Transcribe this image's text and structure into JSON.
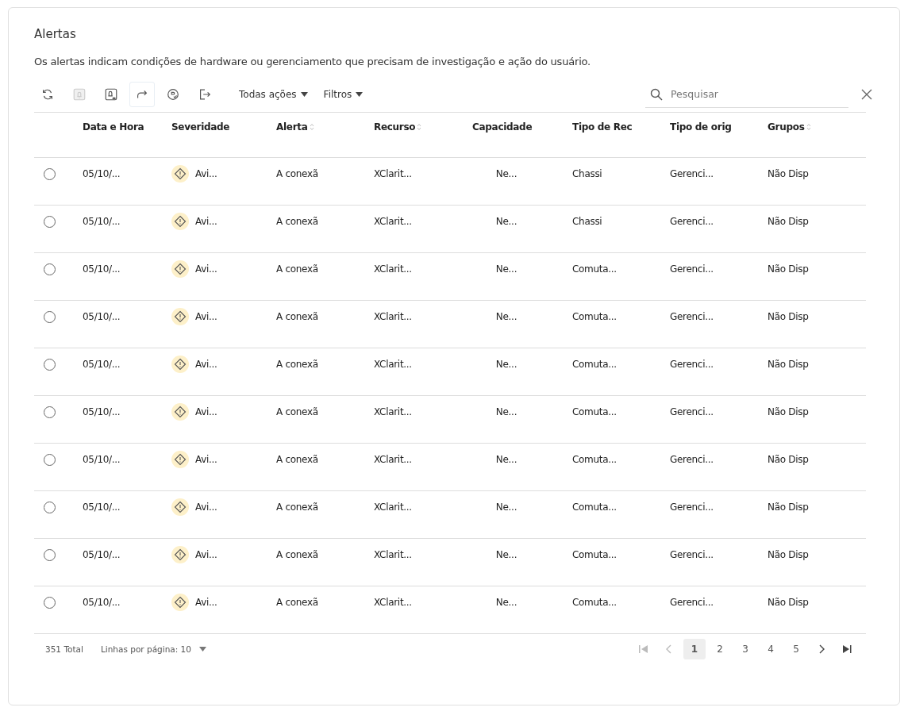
{
  "title": "Alertas",
  "description": "Os alertas indicam condições de hardware ou gerenciamento que precisam de investigação e ação do usuário.",
  "toolbar": {
    "icons": [
      {
        "kind": "refresh",
        "disabled": false
      },
      {
        "kind": "bell",
        "disabled": true
      },
      {
        "kind": "bell-view",
        "disabled": false
      },
      {
        "kind": "forward",
        "disabled": false
      },
      {
        "kind": "circle-check",
        "disabled": false
      },
      {
        "kind": "export",
        "disabled": false
      }
    ],
    "menus": [
      "Todas ações",
      "Filtros"
    ],
    "search": {
      "placeholder": "Pesquisar"
    }
  },
  "table": {
    "columns": [
      {
        "label": "Data e Hora",
        "sortable": false
      },
      {
        "label": "Severidade",
        "sortable": false
      },
      {
        "label": "Alerta",
        "sortable": true
      },
      {
        "label": "Recurso",
        "sortable": true
      },
      {
        "label": "Capacidade",
        "sortable": false
      },
      {
        "label": "Tipo de Rec",
        "sortable": false
      },
      {
        "label": "Tipo de orig",
        "sortable": false
      },
      {
        "label": "Grupos",
        "sortable": true
      }
    ],
    "rows": [
      {
        "selected": false,
        "cells": [
          "05/10/...",
          "Avi...",
          "A conexã",
          "XClarit...",
          "Ne...",
          "Chassi",
          "Gerenci...",
          "Não Disp"
        ]
      },
      {
        "selected": false,
        "cells": [
          "05/10/...",
          "Avi...",
          "A conexã",
          "XClarit...",
          "Ne...",
          "Chassi",
          "Gerenci...",
          "Não Disp"
        ]
      },
      {
        "selected": false,
        "cells": [
          "05/10/...",
          "Avi...",
          "A conexã",
          "XClarit...",
          "Ne...",
          "Comuta...",
          "Gerenci...",
          "Não Disp"
        ]
      },
      {
        "selected": false,
        "cells": [
          "05/10/...",
          "Avi...",
          "A conexã",
          "XClarit...",
          "Ne...",
          "Comuta...",
          "Gerenci...",
          "Não Disp"
        ]
      },
      {
        "selected": false,
        "cells": [
          "05/10/...",
          "Avi...",
          "A conexã",
          "XClarit...",
          "Ne...",
          "Comuta...",
          "Gerenci...",
          "Não Disp"
        ]
      },
      {
        "selected": false,
        "cells": [
          "05/10/...",
          "Avi...",
          "A conexã",
          "XClarit...",
          "Ne...",
          "Comuta...",
          "Gerenci...",
          "Não Disp"
        ]
      },
      {
        "selected": false,
        "cells": [
          "05/10/...",
          "Avi...",
          "A conexã",
          "XClarit...",
          "Ne...",
          "Comuta...",
          "Gerenci...",
          "Não Disp"
        ]
      },
      {
        "selected": false,
        "cells": [
          "05/10/...",
          "Avi...",
          "A conexã",
          "XClarit...",
          "Ne...",
          "Comuta...",
          "Gerenci...",
          "Não Disp"
        ]
      },
      {
        "selected": false,
        "cells": [
          "05/10/...",
          "Avi...",
          "A conexã",
          "XClarit...",
          "Ne...",
          "Comuta...",
          "Gerenci...",
          "Não Disp"
        ]
      },
      {
        "selected": false,
        "cells": [
          "05/10/...",
          "Avi...",
          "A conexã",
          "XClarit...",
          "Ne...",
          "Comuta...",
          "Gerenci...",
          "Não Disp"
        ]
      }
    ]
  },
  "footer": {
    "total": "351 Total",
    "rows_per_page": "Linhas por página: 10",
    "pages": [
      {
        "label": "1",
        "selected": true
      },
      {
        "label": "2",
        "selected": false
      },
      {
        "label": "3",
        "selected": false
      },
      {
        "label": "4",
        "selected": false
      },
      {
        "label": "5",
        "selected": false
      }
    ]
  }
}
